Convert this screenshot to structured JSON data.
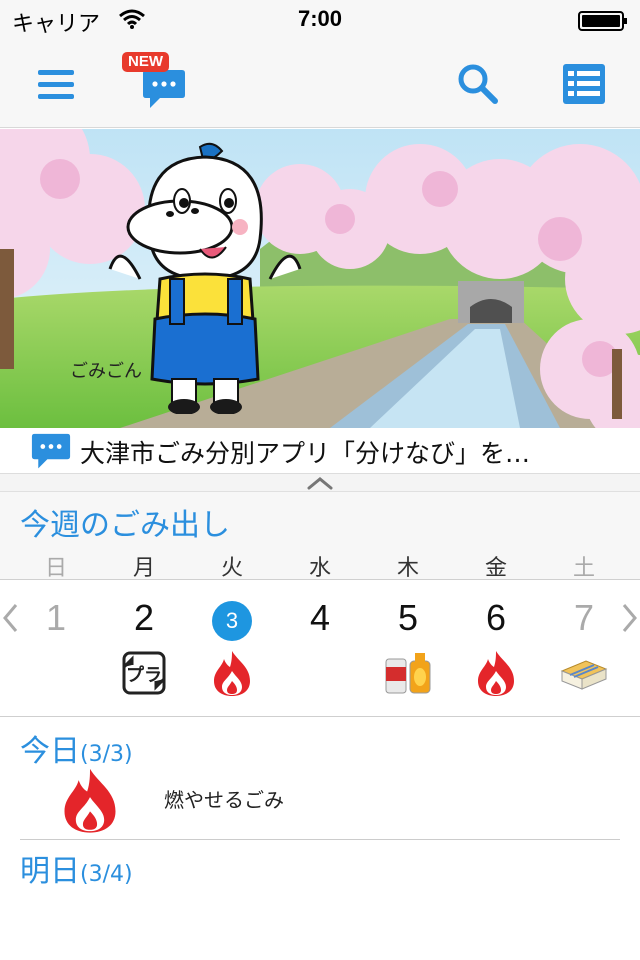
{
  "status_bar": {
    "carrier": "キャリア",
    "time": "7:00"
  },
  "nav": {
    "menu_icon": "hamburger-menu-icon",
    "news_badge": "NEW",
    "news_icon": "speech-bubble-icon",
    "search_icon": "search-icon",
    "list_icon": "list-icon"
  },
  "banner": {
    "mascot_name": "ごみごん"
  },
  "news_ticker": {
    "text": "大津市ごみ分別アプリ「分けなび」を…"
  },
  "week": {
    "title": "今週のごみ出し",
    "weekdays": [
      "日",
      "月",
      "火",
      "水",
      "木",
      "金",
      "土"
    ],
    "days": [
      {
        "num": "1",
        "icon": ""
      },
      {
        "num": "2",
        "icon": "plastic-recycle-icon"
      },
      {
        "num": "3",
        "icon": "fire-icon"
      },
      {
        "num": "4",
        "icon": ""
      },
      {
        "num": "5",
        "icon": "cans-bottles-icon"
      },
      {
        "num": "6",
        "icon": "fire-icon"
      },
      {
        "num": "7",
        "icon": "paper-bundle-icon"
      }
    ],
    "today_index": 2
  },
  "today": {
    "label": "今日",
    "date": "(3/3)",
    "item_label": "燃やせるごみ",
    "item_icon": "fire-icon"
  },
  "tomorrow": {
    "label": "明日",
    "date": "(3/4)"
  },
  "colors": {
    "accent": "#2b8fde",
    "today_circle": "#1e96e0",
    "fire_red": "#e4252a",
    "badge_red": "#e83a2c"
  }
}
